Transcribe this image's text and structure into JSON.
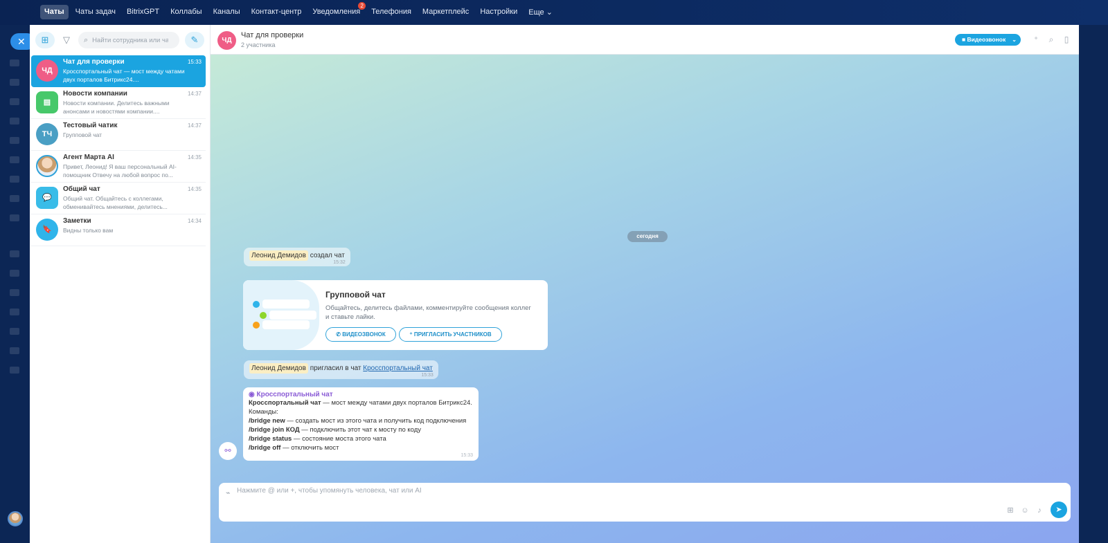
{
  "topnav": {
    "items": [
      "Чаты",
      "Чаты задач",
      "BitrixGPT",
      "Коллабы",
      "Каналы",
      "Контакт-центр",
      "Уведомления",
      "Телефония",
      "Маркетплейс",
      "Настройки",
      "Еще"
    ],
    "notification_badge": "2"
  },
  "sidebar": {
    "search_placeholder": "Найти сотрудника или чат",
    "chats": [
      {
        "initials": "ЧД",
        "name": "Чат для проверки",
        "time": "15:33",
        "message": "Кросспортальный чат — мост между чатами двух порталов Битрикс24....",
        "avatar_color": "#ef5d86"
      },
      {
        "initials": "",
        "name": "Новости компании",
        "time": "14:37",
        "message": "Новости компании. Делитесь важными анонсами и новостями компании....",
        "avatar_color": "#47c86a"
      },
      {
        "initials": "ТЧ",
        "name": "Тестовый чатик",
        "time": "14:37",
        "message": "Групповой чат",
        "avatar_color": "#4a9fc4"
      },
      {
        "initials": "",
        "name": "Агент Марта AI",
        "time": "14:35",
        "message": "Привет, Леонид! Я ваш персональный AI-помощник Отвечу на любой вопрос по...",
        "avatar_color": "#d8b48a"
      },
      {
        "initials": "",
        "name": "Общий чат",
        "time": "14:35",
        "message": "Общий чат. Общайтесь с коллегами, обменивайтесь мнениями, делитесь...",
        "avatar_color": "#39bce8"
      },
      {
        "initials": "",
        "name": "Заметки",
        "time": "14:34",
        "message": "Видны только вам",
        "avatar_color": "#2fb4ea"
      }
    ]
  },
  "chat": {
    "initials": "ЧД",
    "title": "Чат для проверки",
    "subtitle": "2 участника",
    "video_button": "Видеозвонок",
    "date_chip": "сегодня",
    "sys1": {
      "who": "Леонид Демидов",
      "text": "создал чат",
      "time": "15:32"
    },
    "card": {
      "title": "Групповой чат",
      "desc": "Общайтесь, делитесь файлами, комментируйте сообщения коллег и ставьте лайки.",
      "btn_video": "ВИДЕОЗВОНОК",
      "btn_invite": "ПРИГЛАСИТЬ УЧАСТНИКОВ"
    },
    "sys2": {
      "who": "Леонид Демидов",
      "text": "пригласил в чат",
      "link": "Кросспортальный чат",
      "time": "15:33"
    },
    "bot": {
      "author": "Кросспортальный чат",
      "line1_b": "Кросспортальный чат",
      "line1": " — мост между чатами двух порталов Битрикс24.",
      "line2": "Команды:",
      "line3_b": "/bridge new",
      "line3": " — создать мост из этого чата и получить код подключения",
      "line4_b": "/bridge join КОД",
      "line4": " — подключить этот чат к мосту по коду",
      "line5_b": "/bridge status",
      "line5": " — состояние моста этого чата",
      "line6_b": "/bridge off",
      "line6": " — отключить мост",
      "time": "15:33"
    },
    "composer_placeholder": "Нажмите @ или +, чтобы упомянуть человека, чат или AI"
  }
}
